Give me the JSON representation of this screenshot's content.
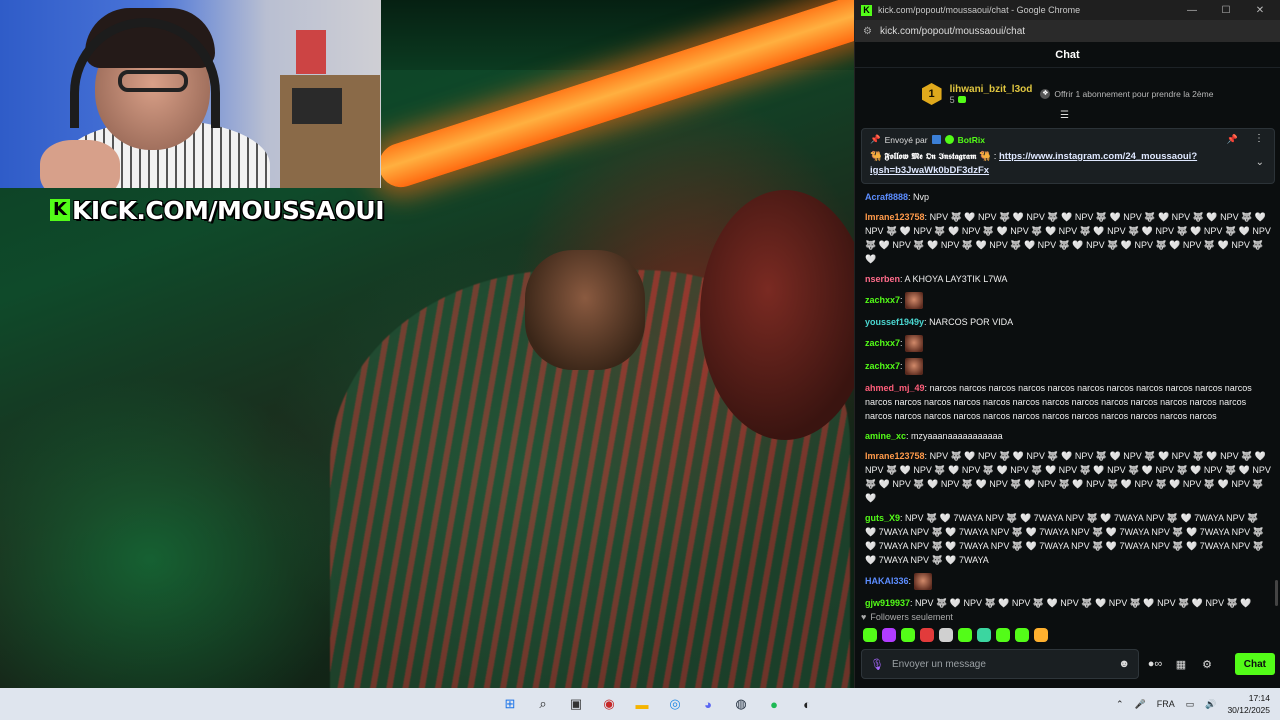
{
  "video": {
    "overlay_text": "KICK.COM/MOUSSAOUI",
    "overlay_logo": "K"
  },
  "window": {
    "title": "kick.com/popout/moussaoui/chat - Google Chrome",
    "url": "kick.com/popout/moussaoui/chat"
  },
  "chat": {
    "header": "Chat",
    "sub_leader": {
      "rank": "1",
      "username": "lihwani_bzit_l3od",
      "count": "5",
      "offer": "Offrir 1 abonnement pour prendre la 2ème"
    },
    "pinned": {
      "sent_by_label": "Envoyé par",
      "bot_name": "BotRix",
      "text_prefix": "𝕱𝖔𝖑𝖑𝖔𝖜 𝕸𝖊 𝕺𝖓 𝕴𝖓𝖘𝖙𝖆𝖌𝖗𝖆𝖒",
      "link": "https://www.instagram.com/24_moussaoui?igsh=b3JwaWk0bDF3dzFx"
    },
    "messages": [
      {
        "user": "Acraf8888",
        "color": "#5c8dff",
        "text": "Nvp",
        "emote": false
      },
      {
        "user": "Imrane123758",
        "color": "#ff9a4a",
        "text": "NPV 🐺 🤍 NPV 🐺 🤍 NPV 🐺 🤍 NPV 🐺 🤍  NPV 🐺 🤍 NPV 🐺 🤍 NPV 🐺 🤍 NPV 🐺 🤍 NPV 🐺 🤍 NPV 🐺 🤍 NPV 🐺 🤍 NPV 🐺 🤍  NPV 🐺 🤍 NPV 🐺 🤍 NPV 🐺 🤍 NPV 🐺 🤍 NPV 🐺 🤍 NPV 🐺 🤍 NPV 🐺 🤍 NPV 🐺 🤍  NPV 🐺 🤍 NPV 🐺 🤍 NPV 🐺 🤍 NPV 🐺 🤍",
        "emote": false
      },
      {
        "user": "nserben",
        "color": "#ff6b8a",
        "text": "A KHOYA LAY3TIK L7WA",
        "emote": false
      },
      {
        "user": "zachxx7",
        "color": "#53fc18",
        "text": "",
        "emote": true
      },
      {
        "user": "youssef1949y",
        "color": "#4bd7d1",
        "text": "NARCOS POR VIDA",
        "emote": false
      },
      {
        "user": "zachxx7",
        "color": "#53fc18",
        "text": "",
        "emote": true
      },
      {
        "user": "zachxx7",
        "color": "#53fc18",
        "text": "",
        "emote": true
      },
      {
        "user": "ahmed_mj_49",
        "color": "#ff5e7a",
        "text": "narcos narcos narcos narcos narcos narcos narcos narcos narcos narcos narcos narcos narcos narcos narcos narcos narcos narcos narcos narcos narcos narcos narcos narcos narcos narcos narcos narcos narcos narcos narcos narcos narcos narcos narcos narcos",
        "emote": false
      },
      {
        "user": "amine_xc",
        "color": "#53fc18",
        "text": "mzyaaanaaaaaaaaaaa",
        "emote": false
      },
      {
        "user": "Imrane123758",
        "color": "#ff9a4a",
        "text": "NPV 🐺 🤍 NPV 🐺 🤍 NPV 🐺 🤍 NPV 🐺 🤍  NPV 🐺 🤍 NPV 🐺 🤍 NPV 🐺 🤍 NPV 🐺 🤍 NPV 🐺 🤍 NPV 🐺 🤍 NPV 🐺 🤍 NPV 🐺 🤍  NPV 🐺 🤍 NPV 🐺 🤍 NPV 🐺 🤍 NPV 🐺 🤍 NPV 🐺 🤍 NPV 🐺 🤍 NPV 🐺 🤍 NPV 🐺 🤍  NPV 🐺 🤍 NPV 🐺 🤍 NPV 🐺 🤍 NPV 🐺 🤍",
        "emote": false
      },
      {
        "user": "guts_X9",
        "color": "#53fc18",
        "text": "NPV 🐺 🤍 7WAYA NPV 🐺 🤍 7WAYA NPV 🐺 🤍 7WAYA NPV 🐺 🤍 7WAYA NPV 🐺 🤍 7WAYA NPV 🐺 🤍 7WAYA NPV 🐺 🤍 7WAYA NPV 🐺 🤍 7WAYA NPV 🐺 🤍 7WAYA NPV 🐺 🤍 7WAYA NPV 🐺 🤍 7WAYA NPV 🐺 🤍 7WAYA NPV 🐺 🤍 7WAYA NPV 🐺 🤍 7WAYA NPV 🐺 🤍 7WAYA NPV 🐺 🤍 7WAYA",
        "emote": false
      },
      {
        "user": "HAKAI336",
        "color": "#5c8dff",
        "text": "",
        "emote": true
      },
      {
        "user": "gjw919937",
        "color": "#53fc18",
        "text": "NPV 🐺 🤍 NPV 🐺 🤍 NPV 🐺 🤍 NPV 🐺 🤍  NPV 🐺 🤍 NPV 🐺 🤍 NPV 🐺 🤍 NPV 🐺 🤍 NPV 🐺 🤍 NPV 🐺 🤍 NPV 🐺 🤍 NPV 🐺 🤍  NPV 🐺 🤍 NPV 🐺 🤍 NPV 🐺 🤍 NPV 🐺 🤍 NPV 🐺 🤍 NPV 🐺 🤍 NPV 🐺 🤍 NPV 🐺 🤍  NPV 🐺 🤍 NPV 🐺 🤍 NPV 🐺 🤍 NPV 🐺 🤍",
        "emote": false
      }
    ],
    "followers_label": "Followers seulement",
    "input_placeholder": "Envoyer un message",
    "send_label": "Chat",
    "emote_colors": [
      "#53fc18",
      "#b23cff",
      "#53fc18",
      "#e23b3b",
      "#d0d0d0",
      "#53fc18",
      "#3bd6a0",
      "#53fc18",
      "#53fc18",
      "#ffb02e"
    ]
  },
  "taskbar": {
    "apps": [
      {
        "name": "windows-start-icon",
        "glyph": "⊞",
        "color": "#1a73e8"
      },
      {
        "name": "search-icon",
        "glyph": "⌕",
        "color": "#222"
      },
      {
        "name": "task-view-icon",
        "glyph": "▣",
        "color": "#333"
      },
      {
        "name": "app-red-icon",
        "glyph": "◉",
        "color": "#c62828"
      },
      {
        "name": "file-explorer-icon",
        "glyph": "▬",
        "color": "#f5b400"
      },
      {
        "name": "chrome-icon",
        "glyph": "◎",
        "color": "#1e88e5"
      },
      {
        "name": "discord-icon",
        "glyph": "◕",
        "color": "#5865f2"
      },
      {
        "name": "steam-icon",
        "glyph": "◍",
        "color": "#1b2838"
      },
      {
        "name": "spotify-icon",
        "glyph": "●",
        "color": "#1db954"
      },
      {
        "name": "obs-icon",
        "glyph": "◐",
        "color": "#222"
      }
    ],
    "language": "FRA",
    "time": "17:14",
    "date": "30/12/2025"
  }
}
